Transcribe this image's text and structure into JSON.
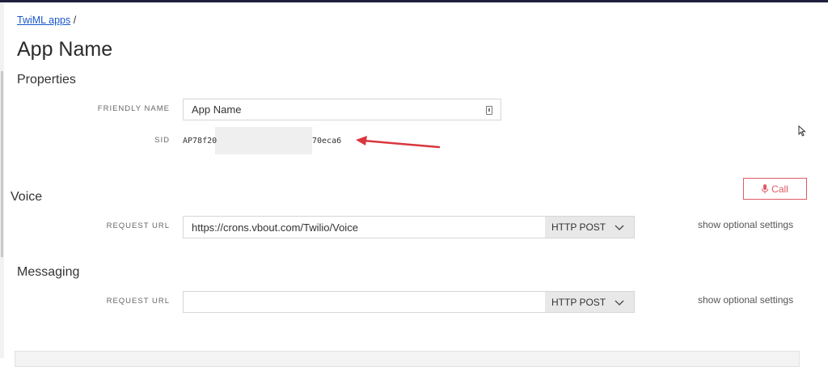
{
  "breadcrumb": {
    "link": "TwiML apps",
    "separator": "/"
  },
  "page_title": "App Name",
  "properties": {
    "heading": "Properties",
    "friendly_name_label": "FRIENDLY NAME",
    "friendly_name_value": "App Name",
    "sid_label": "SID",
    "sid_prefix": "AP78f20",
    "sid_suffix": "70eca6"
  },
  "voice": {
    "heading": "Voice",
    "call_button": "Call",
    "request_url_label": "REQUEST URL",
    "request_url_value": "https://crons.vbout.com/Twilio/Voice",
    "method": "HTTP POST",
    "optional_link": "show optional settings"
  },
  "messaging": {
    "heading": "Messaging",
    "request_url_label": "REQUEST URL",
    "request_url_value": "",
    "method": "HTTP POST",
    "optional_link": "show optional settings"
  },
  "colors": {
    "accent_red": "#e05a66",
    "arrow_red": "#d9363e",
    "link_blue": "#1a57c7"
  }
}
